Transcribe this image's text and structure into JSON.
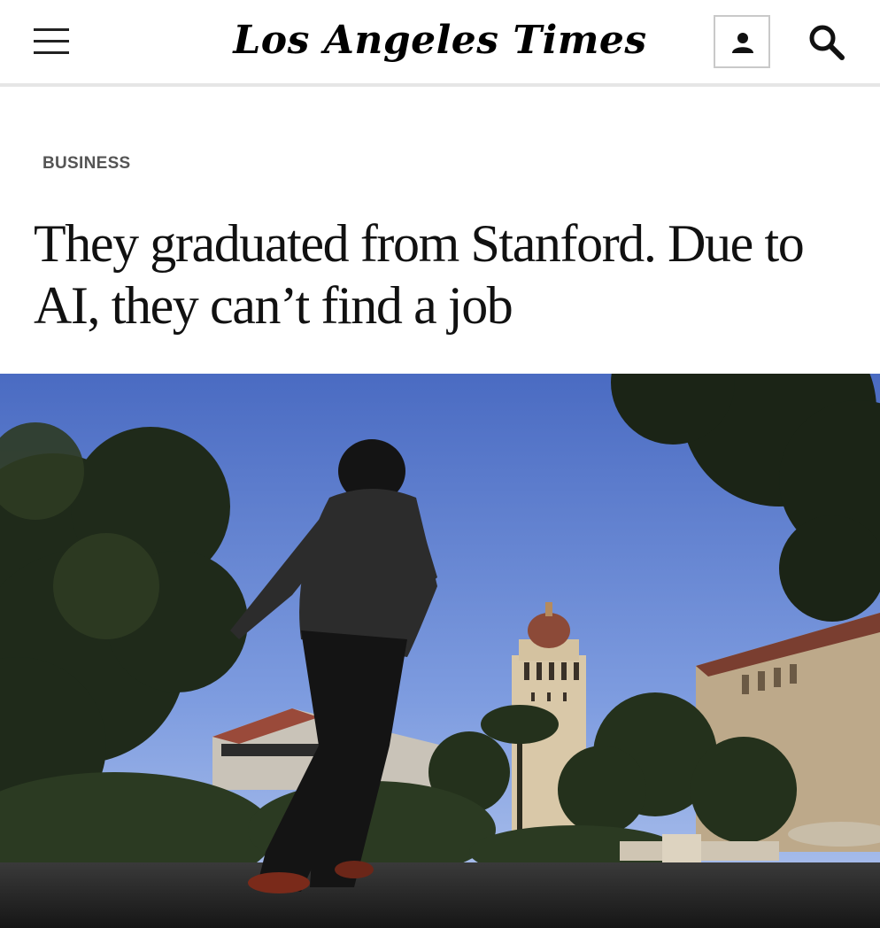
{
  "header": {
    "logo_text": "Los Angeles Times",
    "menu_icon": "hamburger-menu-icon",
    "account_icon": "user-icon",
    "search_icon": "search-icon"
  },
  "article": {
    "section": "BUSINESS",
    "headline": "They graduated from Stanford. Due to AI, they can’t find a job",
    "hero_image": "student walking on campus with Hoover Tower in background"
  },
  "colors": {
    "sky_top": "#4d6fc4",
    "sky_bottom": "#a9c0ef",
    "silhouette": "#141414"
  }
}
